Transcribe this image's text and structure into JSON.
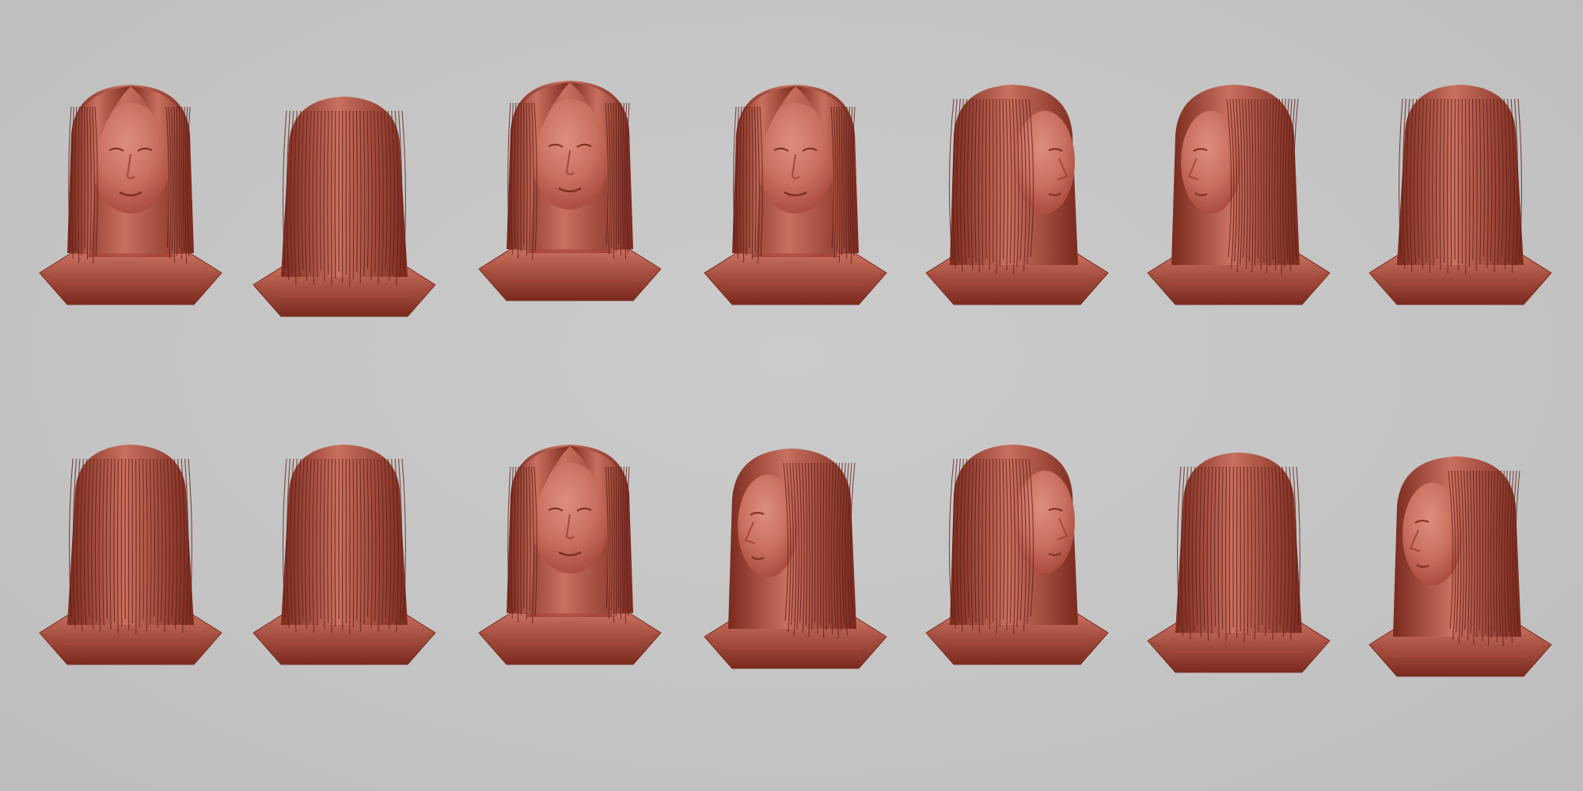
{
  "colors": {
    "background": "#c5c5c5",
    "clay_dark": "#7a2a1e",
    "clay_mid": "#a6473a",
    "clay_light": "#c9705f",
    "clay_highlight": "#dd8e7e",
    "hair_stroke": "#5e1c14"
  },
  "views": [
    {
      "id": "r1-front-tilt",
      "pose": "front",
      "row": 1
    },
    {
      "id": "r1-side-left",
      "pose": "side-back-left",
      "row": 1
    },
    {
      "id": "r1-front",
      "pose": "front",
      "row": 1
    },
    {
      "id": "r1-front-b",
      "pose": "front",
      "row": 1
    },
    {
      "id": "r1-three-quarter-right",
      "pose": "three-quarter-right",
      "row": 1
    },
    {
      "id": "r1-three-quarter-left",
      "pose": "three-quarter-left",
      "row": 1
    },
    {
      "id": "r1-back-right",
      "pose": "back-right",
      "row": 1
    },
    {
      "id": "r2-back-left",
      "pose": "back-left",
      "row": 2
    },
    {
      "id": "r2-back",
      "pose": "back",
      "row": 2
    },
    {
      "id": "r2-front-down",
      "pose": "front-down",
      "row": 2
    },
    {
      "id": "r2-top-left",
      "pose": "top-three-quarter-left",
      "row": 2
    },
    {
      "id": "r2-three-quarter-right",
      "pose": "three-quarter-right",
      "row": 2
    },
    {
      "id": "r2-back-low",
      "pose": "back-low",
      "row": 2
    },
    {
      "id": "r2-side-left",
      "pose": "three-quarter-left",
      "row": 2
    }
  ]
}
